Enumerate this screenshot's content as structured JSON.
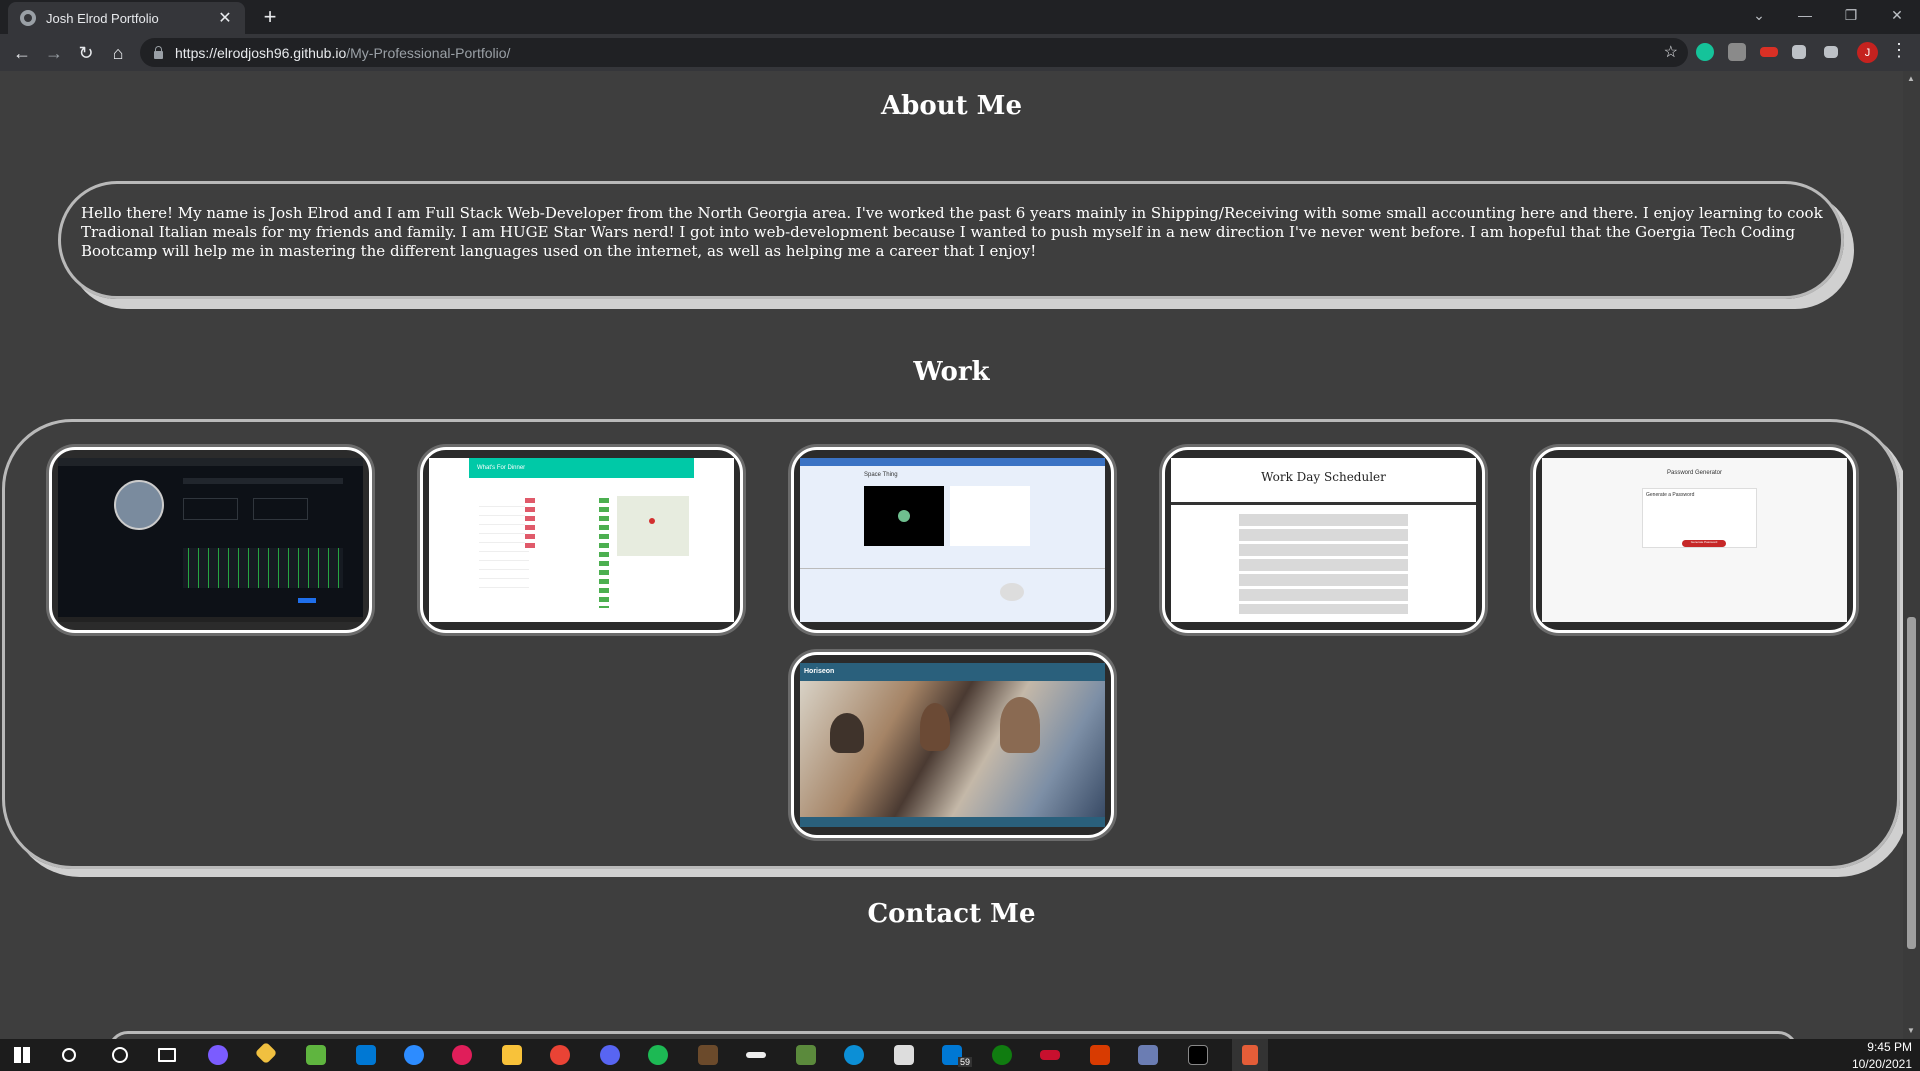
{
  "browser": {
    "tab_title": "Josh Elrod Portfolio",
    "tab_close": "✕",
    "new_tab": "+",
    "url_host": "https://elrodjosh96.github.io",
    "url_path": "/My-Professional-Portfolio/",
    "profile_initial": "J"
  },
  "page": {
    "about_title": "About Me",
    "about_text": "Hello there! My name is Josh Elrod and I am Full Stack Web-Developer from the North Georgia area. I've worked the past 6 years mainly in Shipping/Receiving with some small accounting here and there. I enjoy learning to cook Tradional Italian meals for my friends and family. I am HUGE Star Wars nerd! I got into web-development because I wanted to push myself in a new direction I've never went before. I am hopeful that the Goergia Tech Coding Bootcamp will help me in mastering the different languages used on the internet, as well as helping me a career that I enjoy!",
    "work_title": "Work",
    "contact_title": "Contact Me",
    "work_items": [
      {
        "name": "github-profile-project",
        "label": ""
      },
      {
        "name": "whats-for-dinner-project",
        "label": "What's For Dinner"
      },
      {
        "name": "space-thing-project",
        "label": "Space Thing"
      },
      {
        "name": "work-day-scheduler-project",
        "label": "Work Day Scheduler"
      },
      {
        "name": "password-generator-project",
        "label": "Password Generator"
      },
      {
        "name": "horiseon-project",
        "label": "Horiseon"
      }
    ],
    "password_generator_sub": "Generate a Password",
    "password_button": "Generate Password"
  },
  "taskbar": {
    "time": "9:45 PM",
    "date": "10/20/2021",
    "mail_badge": "59"
  }
}
